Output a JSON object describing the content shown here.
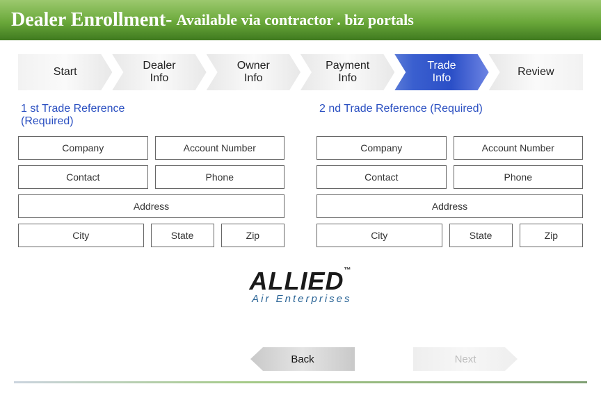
{
  "header": {
    "title": "Dealer Enrollment-",
    "subtitle": "Available via contractor . biz portals"
  },
  "steps": {
    "s0": "Start",
    "s1": "Dealer\nInfo",
    "s2": "Owner\nInfo",
    "s3": "Payment\nInfo",
    "s4": "Trade\nInfo",
    "s5": "Review"
  },
  "left": {
    "title": "1 st Trade Reference\n(Required)",
    "company": "Company",
    "account": "Account Number",
    "contact": "Contact",
    "phone": "Phone",
    "address": "Address",
    "city": "City",
    "state": "State",
    "zip": "Zip"
  },
  "right": {
    "title": "2 nd Trade Reference (Required)",
    "company": "Company",
    "account": "Account Number",
    "contact": "Contact",
    "phone": "Phone",
    "address": "Address",
    "city": "City",
    "state": "State",
    "zip": "Zip"
  },
  "logo": {
    "top": "ALLIED",
    "tm": "™",
    "bottom": "Air Enterprises"
  },
  "nav": {
    "back": "Back",
    "next": "Next"
  }
}
